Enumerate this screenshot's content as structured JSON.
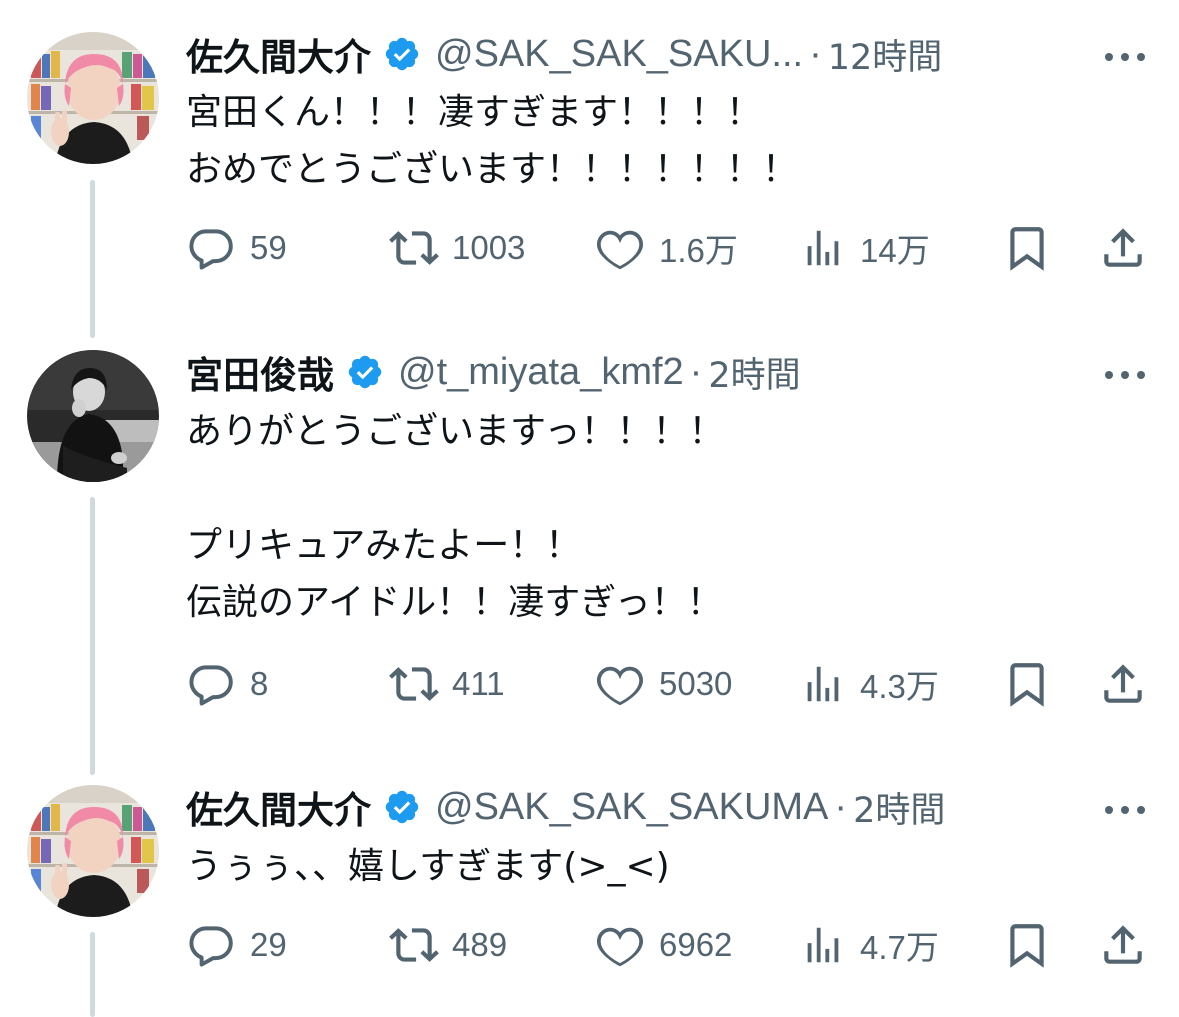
{
  "tweets": [
    {
      "name": "佐久間大介",
      "handle": "@SAK_SAK_SAKU...",
      "separator": "·",
      "time": "12時間",
      "text_lines": [
        "宮田くん！！！凄すぎます！！！！",
        "おめでとうございます！！！！！！！"
      ],
      "avatar": "avatar-pink-hair",
      "reply_count": "59",
      "retweet_count": "1003",
      "like_count": "1.6万",
      "view_count": "14万"
    },
    {
      "name": "宮田俊哉",
      "handle": "@t_miyata_kmf2",
      "separator": "·",
      "time": "2時間",
      "text_lines": [
        "ありがとうございますっ！！！！",
        "",
        "プリキュアみたよー！！",
        "伝説のアイドル！！凄すぎっ！！"
      ],
      "avatar": "avatar-monochrome",
      "reply_count": "8",
      "retweet_count": "411",
      "like_count": "5030",
      "view_count": "4.3万"
    },
    {
      "name": "佐久間大介",
      "handle": "@SAK_SAK_SAKUMA",
      "separator": "·",
      "time": "2時間",
      "text_lines": [
        "うぅぅ、、嬉しすぎます(>_<)"
      ],
      "avatar": "avatar-pink-hair",
      "reply_count": "29",
      "retweet_count": "489",
      "like_count": "6962",
      "view_count": "4.7万"
    }
  ],
  "icons": {
    "verified": "verified-badge-icon",
    "more": "more-icon",
    "reply": "reply-icon",
    "retweet": "retweet-icon",
    "like": "heart-icon",
    "views": "views-icon",
    "bookmark": "bookmark-icon",
    "share": "share-icon"
  },
  "colors": {
    "text": "#0f1419",
    "secondary": "#536471",
    "verified": "#1d9bf0",
    "thread_line": "#cfd9de"
  }
}
